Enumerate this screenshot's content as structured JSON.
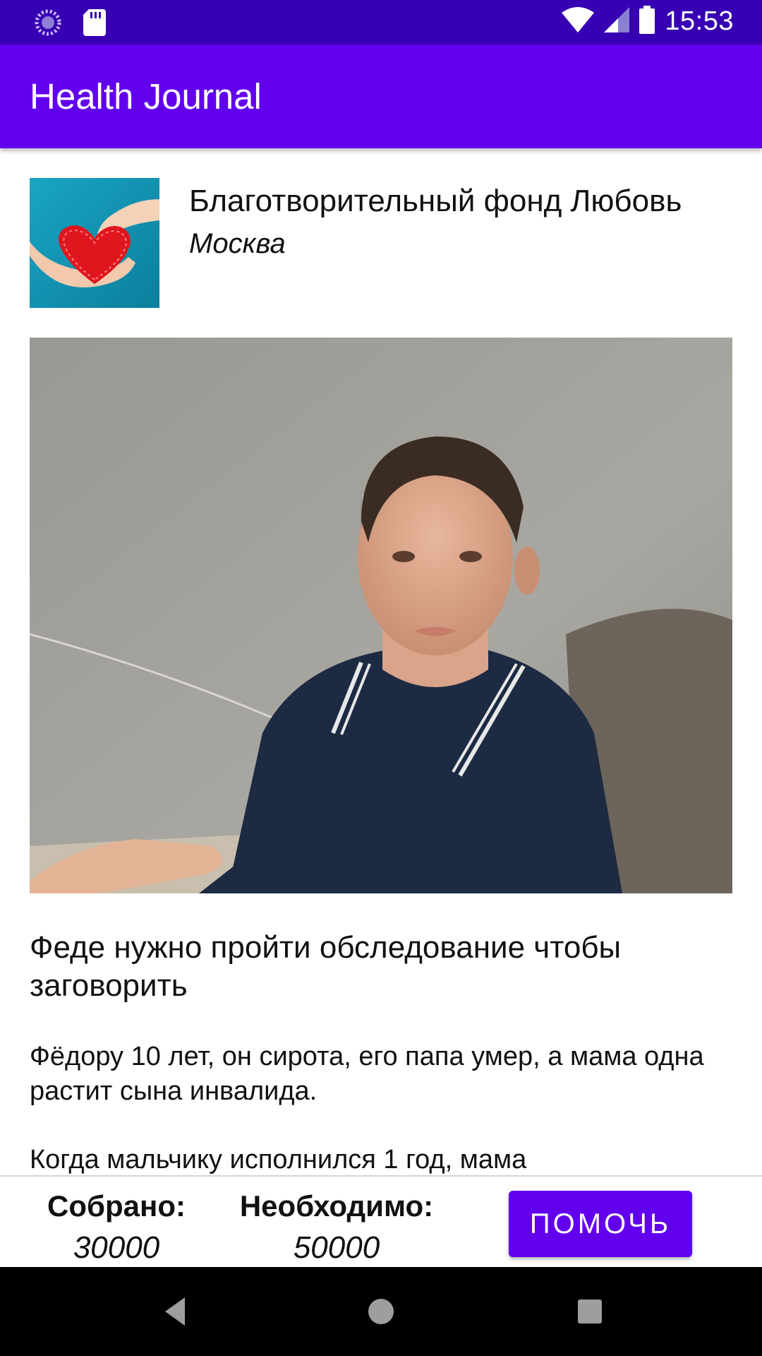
{
  "status_bar": {
    "time": "15:53",
    "icons": [
      "sync-icon",
      "sd-card-icon",
      "wifi-icon",
      "signal-icon",
      "battery-icon"
    ]
  },
  "app_bar": {
    "title": "Health Journal"
  },
  "fund": {
    "name": "Благотворительный фонд Любовь",
    "city": "Москва"
  },
  "story": {
    "title": "Феде нужно пройти обследование чтобы заговорить",
    "paragraph1": "Фёдору 10 лет, он сирота, его папа умер, а мама одна растит сына инвалида.",
    "paragraph2": "Когда мальчику исполнился 1 год, мама"
  },
  "stats": {
    "collected_label": "Собрано:",
    "collected_value": "30000",
    "needed_label": "Необходимо:",
    "needed_value": "50000"
  },
  "help_button": {
    "label": "ПОМОЧЬ"
  },
  "colors": {
    "primary": "#6200EE",
    "primary_dark": "#3700B3"
  },
  "nav": {
    "icons": [
      "back-icon",
      "home-icon",
      "recents-icon"
    ]
  }
}
